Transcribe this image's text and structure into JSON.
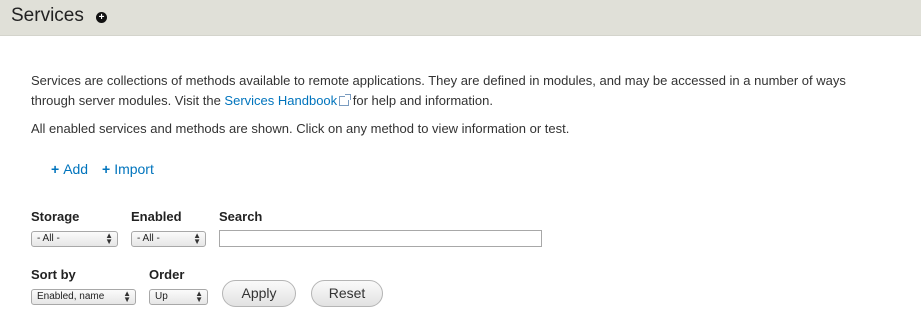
{
  "header": {
    "title": "Services",
    "shortcut_icon": "plus-circle-icon"
  },
  "intro": {
    "line1": "Services are collections of methods available to remote applications. They are defined in modules, and may be accessed in a number of ways",
    "line2_before": "through server modules. Visit the ",
    "handbook_link": "Services Handbook",
    "line2_after": " for help and information.",
    "line3": "All enabled services and methods are shown. Click on any method to view information or test."
  },
  "actions": {
    "add_label": "Add",
    "import_label": "Import"
  },
  "filters": {
    "storage_label": "Storage",
    "storage_value": "- All -",
    "enabled_label": "Enabled",
    "enabled_value": "- All -",
    "search_label": "Search",
    "search_value": "",
    "sort_label": "Sort by",
    "sort_value": "Enabled, name",
    "order_label": "Order",
    "order_value": "Up",
    "apply_label": "Apply",
    "reset_label": "Reset"
  }
}
